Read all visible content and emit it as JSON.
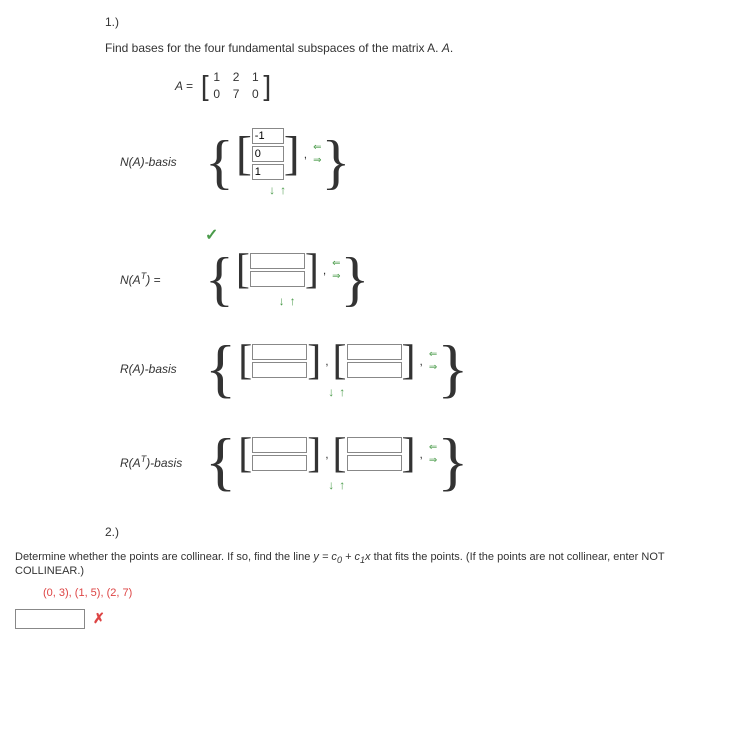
{
  "p1": {
    "number": "1.)",
    "prompt": "Find bases for the four fundamental subspaces of the matrix A.",
    "matrix_label": "A =",
    "matrix": {
      "r1": {
        "c1": "1",
        "c2": "2",
        "c3": "1"
      },
      "r2": {
        "c1": "0",
        "c2": "7",
        "c3": "0"
      }
    },
    "na": {
      "label": "N(A)-basis",
      "v1": "-1",
      "v2": "0",
      "v3": "1"
    },
    "nat": {
      "label_html": "N(A^T) ="
    },
    "ra": {
      "label": "R(A)-basis"
    },
    "rat": {
      "label_html": "R(A^T)-basis"
    }
  },
  "p2": {
    "number": "2.)",
    "prompt_pre": "Determine whether the points are collinear. If so, find the line ",
    "eq": "y = c0 + c1x",
    "prompt_post": " that fits the points. (If the points are not collinear, enter NOT COLLINEAR.)",
    "points": "(0, 3), (1, 5), (2, 7)"
  },
  "arrows": {
    "left": "⇐",
    "right": "⇒",
    "down": "↓",
    "up": "↑"
  }
}
